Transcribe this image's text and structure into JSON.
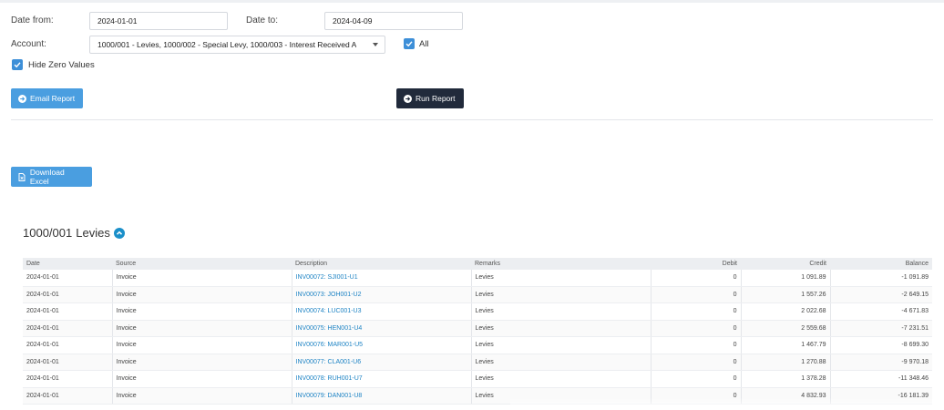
{
  "filters": {
    "date_from_label": "Date from:",
    "date_from_value": "2024-01-01",
    "date_to_label": "Date to:",
    "date_to_value": "2024-04-09",
    "account_label": "Account:",
    "account_value": "1000/001 - Levies, 1000/002 - Special Levy, 1000/003 - Interest Received A",
    "all_label": "All",
    "all_checked": true,
    "hide_zero_label": "Hide Zero Values",
    "hide_zero_checked": true
  },
  "buttons": {
    "email_report": "Email Report",
    "run_report": "Run Report",
    "download_excel": "Download Excel"
  },
  "colors": {
    "primary": "#4a9ee0",
    "dark": "#212a3b",
    "link": "#1d83c4",
    "toggle": "#1a8fc9"
  },
  "section": {
    "code": "1000/001",
    "name": "Levies"
  },
  "table": {
    "columns": [
      "Date",
      "Source",
      "Description",
      "Remarks",
      "Debit",
      "Credit",
      "Balance"
    ],
    "rows": [
      {
        "date": "2024-01-01",
        "source": "Invoice",
        "description": "INV00072: SJI001-U1",
        "remarks": "Levies",
        "debit": "0",
        "credit": "1 091.89",
        "balance": "-1 091.89"
      },
      {
        "date": "2024-01-01",
        "source": "Invoice",
        "description": "INV00073: JOH001-U2",
        "remarks": "Levies",
        "debit": "0",
        "credit": "1 557.26",
        "balance": "-2 649.15"
      },
      {
        "date": "2024-01-01",
        "source": "Invoice",
        "description": "INV00074: LUC001-U3",
        "remarks": "Levies",
        "debit": "0",
        "credit": "2 022.68",
        "balance": "-4 671.83"
      },
      {
        "date": "2024-01-01",
        "source": "Invoice",
        "description": "INV00075: HEN001-U4",
        "remarks": "Levies",
        "debit": "0",
        "credit": "2 559.68",
        "balance": "-7 231.51"
      },
      {
        "date": "2024-01-01",
        "source": "Invoice",
        "description": "INV00076: MAR001-U5",
        "remarks": "Levies",
        "debit": "0",
        "credit": "1 467.79",
        "balance": "-8 699.30"
      },
      {
        "date": "2024-01-01",
        "source": "Invoice",
        "description": "INV00077: CLA001-U6",
        "remarks": "Levies",
        "debit": "0",
        "credit": "1 270.88",
        "balance": "-9 970.18"
      },
      {
        "date": "2024-01-01",
        "source": "Invoice",
        "description": "INV00078: RUH001-U7",
        "remarks": "Levies",
        "debit": "0",
        "credit": "1 378.28",
        "balance": "-11 348.46"
      },
      {
        "date": "2024-01-01",
        "source": "Invoice",
        "description": "INV00079: DAN001-U8",
        "remarks": "Levies",
        "debit": "0",
        "credit": "4 832.93",
        "balance": "-16 181.39"
      }
    ]
  }
}
